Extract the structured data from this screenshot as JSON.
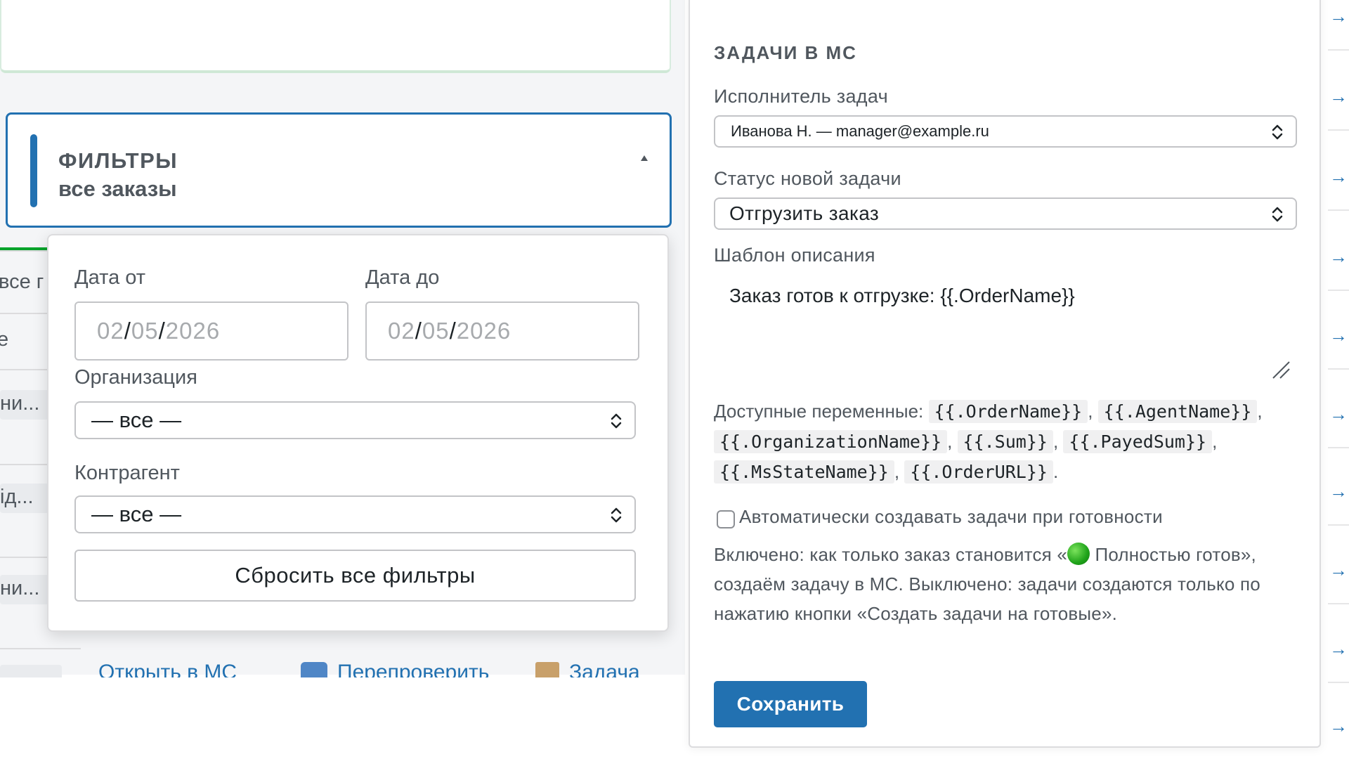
{
  "filters": {
    "title": "ФИЛЬТРЫ",
    "subtitle": "все заказы",
    "toggle_icon": "caret-up-icon",
    "date_from_label": "Дата от",
    "date_to_label": "Дата до",
    "date_from": {
      "mm": "02",
      "dd": "05",
      "yyyy": "2026"
    },
    "date_to": {
      "mm": "02",
      "dd": "05",
      "yyyy": "2026"
    },
    "org_label": "Организация",
    "org_value": "— все —",
    "agent_label": "Контрагент",
    "agent_value": "— все —",
    "reset_label": "Сбросить все фильтры"
  },
  "background": {
    "tab_text": "все г",
    "row_marker": "е",
    "row1_text": "ни...",
    "row2_text": "ід...",
    "row3_text": "ни...",
    "link_open": "Открыть в МС",
    "link_recheck": "Перепроверить",
    "link_task": "Задача"
  },
  "settings": {
    "section_title": "ЗАДАЧИ В МС",
    "assignee_label": "Исполнитель задач",
    "assignee_value": "Иванова Н. — manager@example.ru",
    "status_label": "Статус новой задачи",
    "status_value": "Отгрузить заказ",
    "template_label": "Шаблон описания",
    "template_value": "Заказ готов к отгрузке: {{.OrderName}}",
    "vars_prefix": "Доступные переменные:",
    "vars": [
      "{{.OrderName}}",
      "{{.AgentName}}",
      "{{.OrganizationName}}",
      "{{.Sum}}",
      "{{.PayedSum}}",
      "{{.MsStateName}}",
      "{{.OrderURL}}"
    ],
    "auto_label": "Автоматически создавать задачи при готовности",
    "auto_checked": false,
    "help_part1": "Включено: как только заказ становится «",
    "help_part2": " Полностью готов», создаём задачу в МС. Выключено: задачи создаются только по нажатию кнопки «Создать задачи на готовые».",
    "save_label": "Сохранить"
  },
  "right_strip": {
    "arrow": "→"
  },
  "colors": {
    "accent": "#2271b1",
    "green": "#00a32a",
    "muted_text": "#50575e"
  }
}
